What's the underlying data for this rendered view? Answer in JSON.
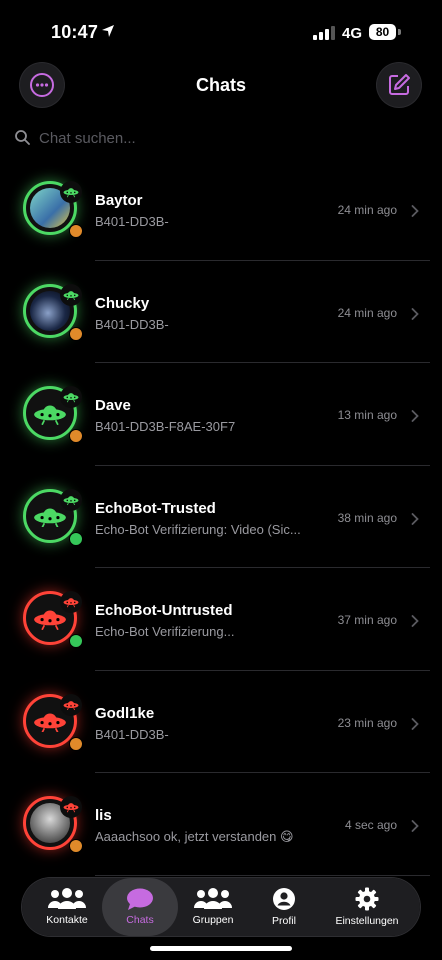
{
  "status_bar": {
    "time": "10:47",
    "network": "4G",
    "battery": "80"
  },
  "header": {
    "title": "Chats"
  },
  "search": {
    "placeholder": "Chat suchen..."
  },
  "colors": {
    "accent": "#c66be0",
    "trusted": "#4cd964",
    "untrusted": "#ff4338",
    "away": "#e08a2a"
  },
  "chats": [
    {
      "name": "Baytor",
      "preview": "B401-DD3B-",
      "time": "24 min ago",
      "ring": "green",
      "status": "away"
    },
    {
      "name": "Chucky",
      "preview": "B401-DD3B-",
      "time": "24 min ago",
      "ring": "green",
      "status": "away"
    },
    {
      "name": "Dave",
      "preview": "B401-DD3B-F8AE-30F7",
      "time": "13 min ago",
      "ring": "green",
      "status": "away"
    },
    {
      "name": "EchoBot-Trusted",
      "preview": "Echo-Bot Verifizierung: Video (Sic...",
      "time": "38 min ago",
      "ring": "green",
      "status": "online"
    },
    {
      "name": "EchoBot-Untrusted",
      "preview": "Echo-Bot Verifizierung...",
      "time": "37 min ago",
      "ring": "red",
      "status": "online"
    },
    {
      "name": "Godl1ke",
      "preview": "B401-DD3B-",
      "time": "23 min ago",
      "ring": "red",
      "status": "away"
    },
    {
      "name": "lis",
      "preview": "Aaaachsoo ok, jetzt verstanden 😋",
      "time": "4 sec ago",
      "ring": "red",
      "status": "away"
    }
  ],
  "tabs": [
    {
      "label": "Kontakte",
      "icon": "contacts-icon"
    },
    {
      "label": "Chats",
      "icon": "chat-bubble-icon",
      "active": true
    },
    {
      "label": "Gruppen",
      "icon": "groups-icon"
    },
    {
      "label": "Profil",
      "icon": "profile-icon"
    },
    {
      "label": "Einstellungen",
      "icon": "gear-icon"
    }
  ]
}
